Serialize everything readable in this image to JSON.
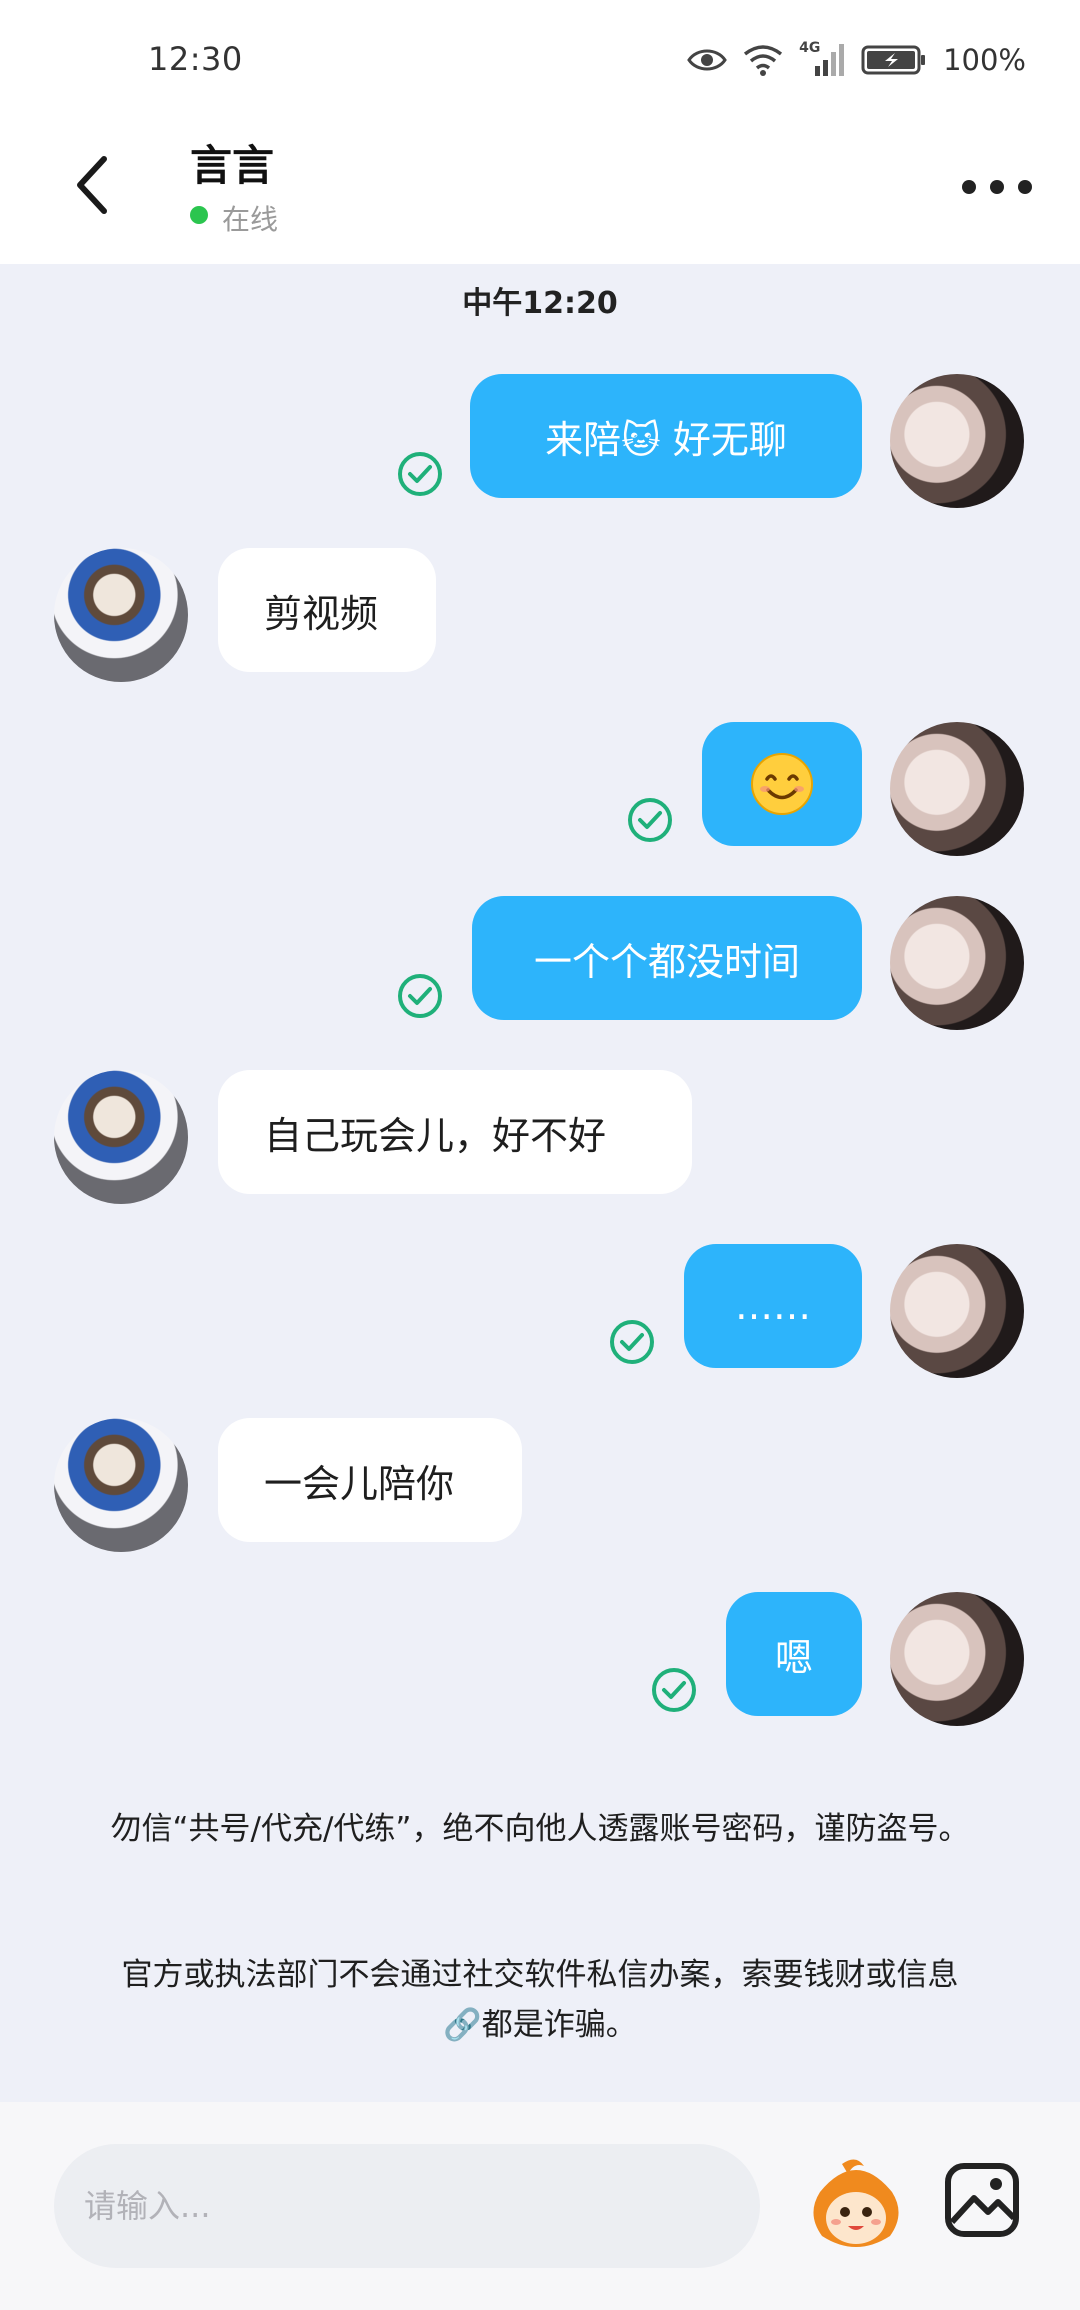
{
  "status_bar": {
    "time": "12:30",
    "network": "4G",
    "battery": "100%"
  },
  "header": {
    "contact_name": "言言",
    "status": "在线"
  },
  "chat": {
    "timestamp": "中午12:20",
    "messages": [
      {
        "sender": "me",
        "text": "来陪🐱  好无聊",
        "read": true
      },
      {
        "sender": "other",
        "text": "剪视频"
      },
      {
        "sender": "me",
        "text": "",
        "emoji": "smiling-face",
        "read": true
      },
      {
        "sender": "me",
        "text": "一个个都没时间",
        "read": true
      },
      {
        "sender": "other",
        "text": "自己玩会儿，好不好"
      },
      {
        "sender": "me",
        "text": "……",
        "read": true
      },
      {
        "sender": "other",
        "text": "一会儿陪你"
      },
      {
        "sender": "me",
        "text": "嗯",
        "read": true
      }
    ]
  },
  "notice": {
    "line1": "勿信“共号/代充/代练”，绝不向他人透露账号密码，谨防盗号。",
    "line2": "官方或执法部门不会通过社交软件私信办案，索要钱财或信息🔗都是诈骗。"
  },
  "input": {
    "placeholder": "请输入..."
  },
  "colors": {
    "my_bubble": "#2db4fb",
    "other_bubble": "#ffffff",
    "background": "#eef0f8",
    "online_dot": "#2bc54f",
    "read_check": "#1fb07a"
  }
}
